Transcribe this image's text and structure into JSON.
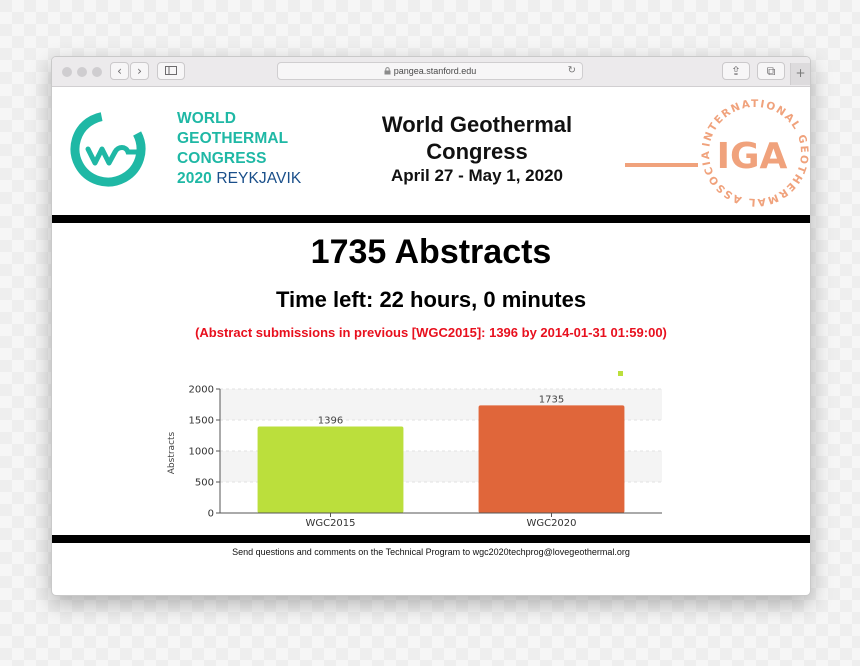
{
  "browser": {
    "url": "pangea.stanford.edu",
    "back_glyph": "‹",
    "forward_glyph": "›",
    "reload_glyph": "↻",
    "share_glyph": "⇪",
    "tabs_glyph": "⧉",
    "new_tab_glyph": "+"
  },
  "header": {
    "wgc_line1": "WORLD",
    "wgc_line2": "GEOTHERMAL",
    "wgc_line3": "CONGRESS",
    "wgc_year": "2020",
    "wgc_city": "REYKJAVIK",
    "title_line1": "World Geothermal",
    "title_line2": "Congress",
    "dates": "April 27 - May 1, 2020",
    "iga_text": "IGA",
    "iga_ring": "INTERNATIONAL GEOTHERMAL ASSOCIATION",
    "wgc_color": "#1fb8a5",
    "iga_color": "#f0a27c"
  },
  "main": {
    "abstracts": "1735 Abstracts",
    "time_left": "Time left: 22 hours, 0 minutes",
    "previous": "(Abstract submissions in previous [WGC2015]: 1396 by 2014-01-31 01:59:00)"
  },
  "chart_data": {
    "type": "bar",
    "categories": [
      "WGC2015",
      "WGC2020"
    ],
    "values": [
      1396,
      1735
    ],
    "value_labels": [
      "1396",
      "1735"
    ],
    "colors": [
      "#bbdf3c",
      "#e0663a"
    ],
    "ylabel": "Abstracts",
    "xlabel": "",
    "ylim": [
      0,
      2000
    ],
    "yticks": [
      0,
      500,
      1000,
      1500,
      2000
    ],
    "ytick_labels": [
      "0",
      "500",
      "1000",
      "1500",
      "2000"
    ],
    "grid": true,
    "legend": "top-right"
  },
  "footer": {
    "text": "Send questions and comments on the Technical Program to wgc2020techprog@lovegeothermal.org"
  }
}
